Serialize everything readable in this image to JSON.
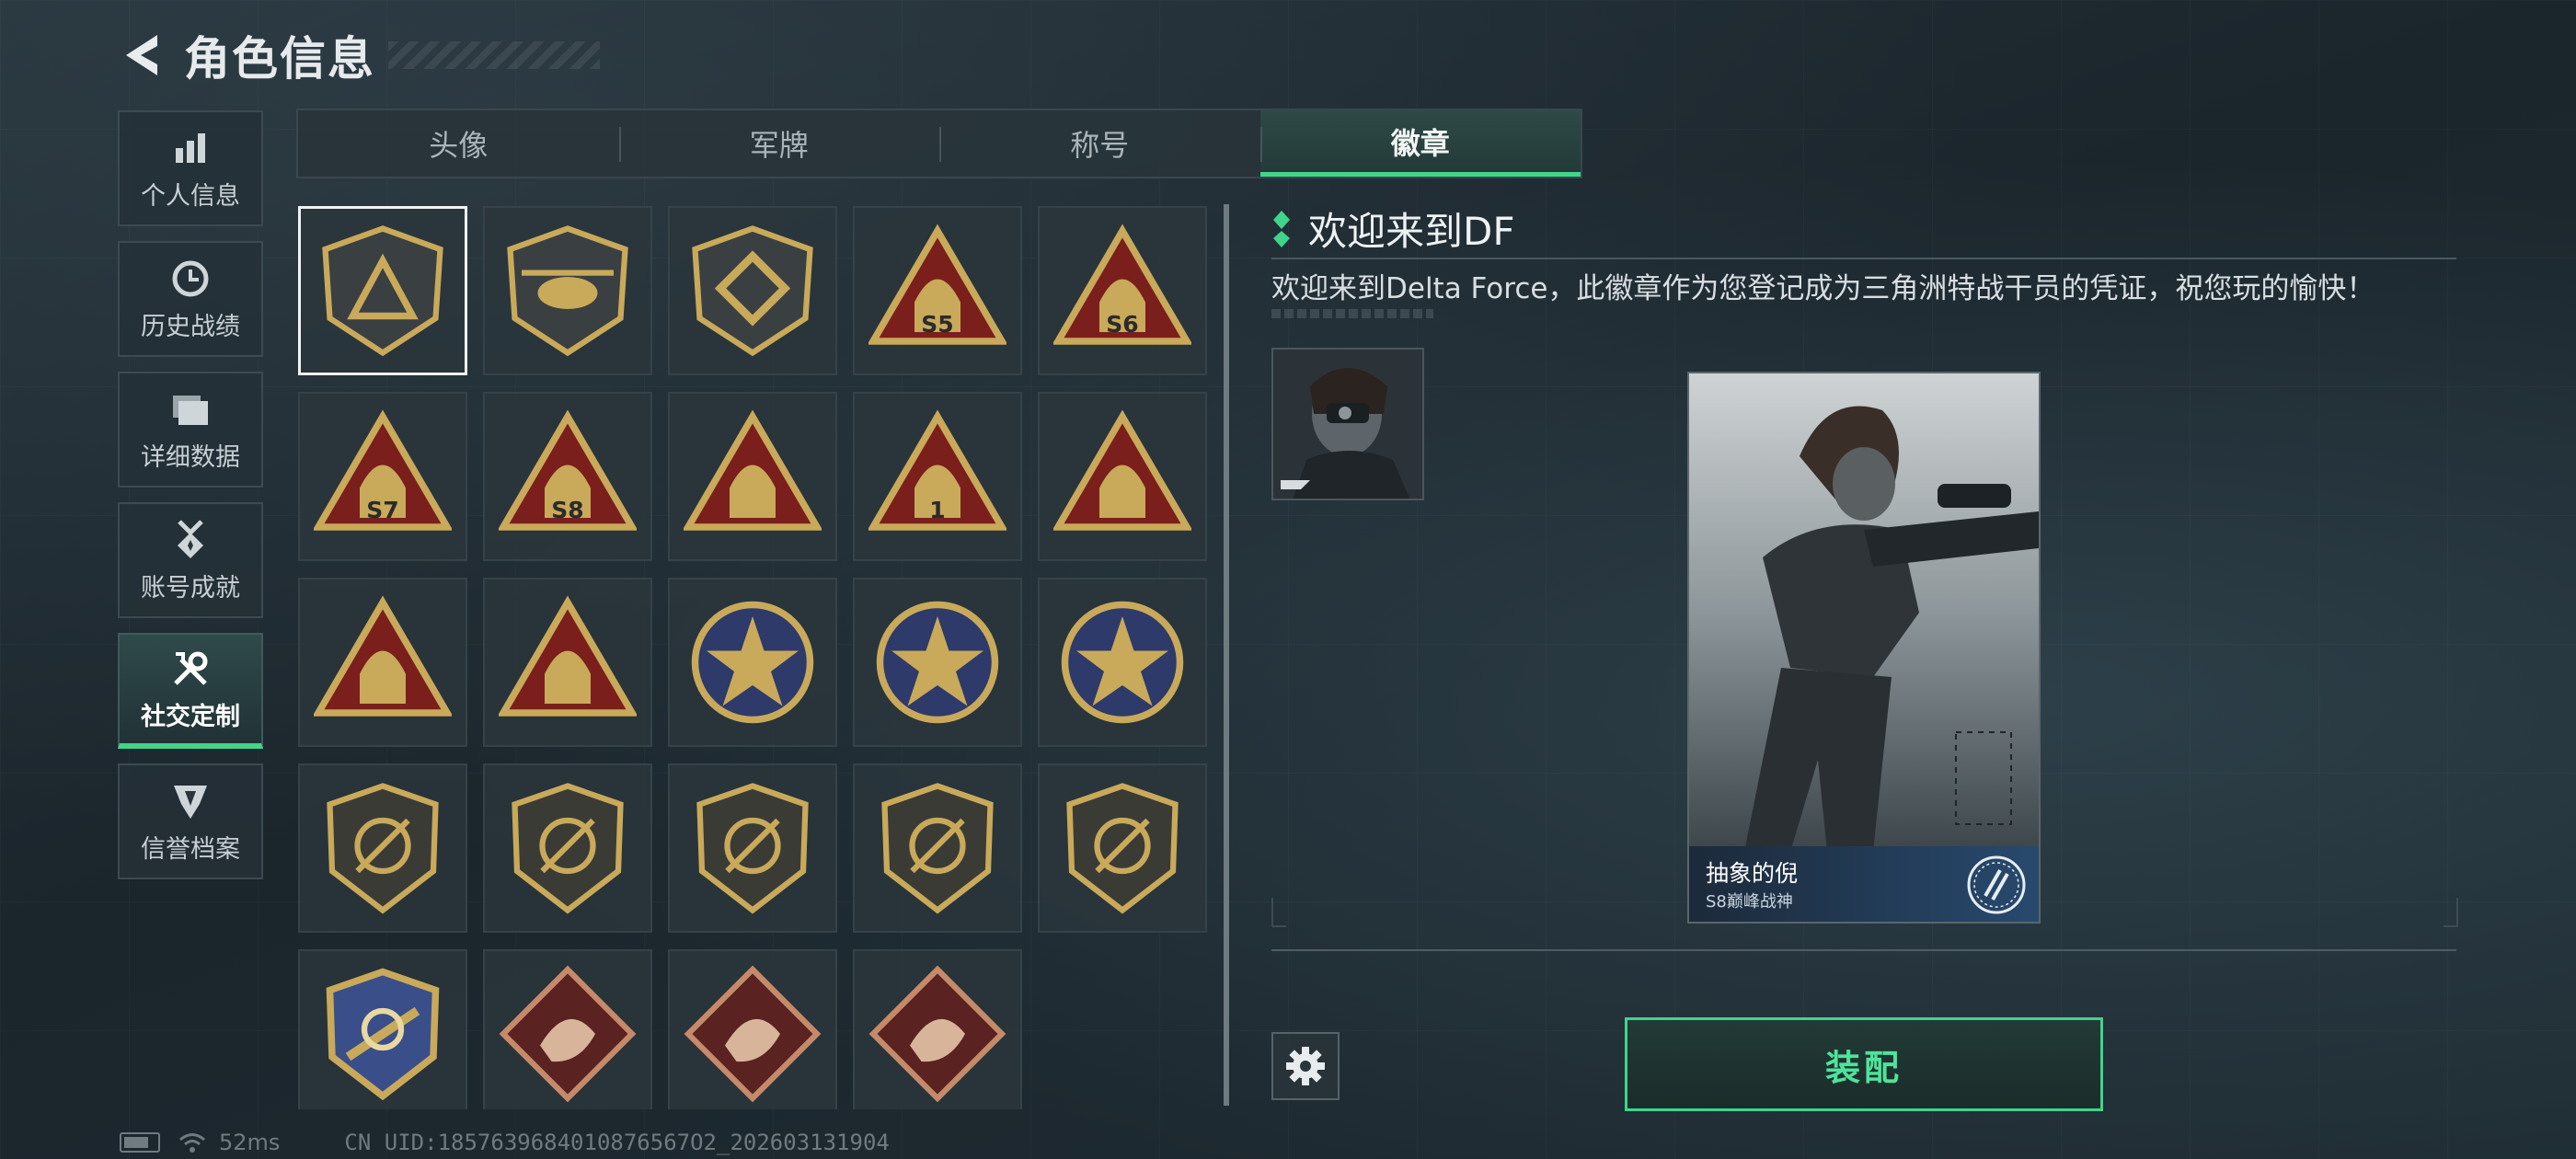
{
  "header": {
    "title": "角色信息",
    "back_icon": "back-arrow-icon"
  },
  "sidenav": {
    "items": [
      {
        "label": "个人信息",
        "icon": "bar-chart-icon",
        "active": false
      },
      {
        "label": "历史战绩",
        "icon": "clock-icon",
        "active": false
      },
      {
        "label": "详细数据",
        "icon": "folder-icon",
        "active": false
      },
      {
        "label": "账号成就",
        "icon": "medal-star-icon",
        "active": false
      },
      {
        "label": "社交定制",
        "icon": "wrench-screwdriver-icon",
        "active": true
      },
      {
        "label": "信誉档案",
        "icon": "shield-chevron-icon",
        "active": false
      }
    ]
  },
  "tabs": [
    {
      "label": "头像",
      "active": false
    },
    {
      "label": "军牌",
      "active": false
    },
    {
      "label": "称号",
      "active": false
    },
    {
      "label": "徽章",
      "active": true
    }
  ],
  "badges": [
    {
      "name": "delta-triangle-badge",
      "text": ""
    },
    {
      "name": "helicopter-badge",
      "text": ""
    },
    {
      "name": "hexagon-emblem-badge",
      "text": ""
    },
    {
      "name": "season-s5-badge",
      "text": "S5"
    },
    {
      "name": "season-s6-badge",
      "text": "S6"
    },
    {
      "name": "season-s7-badge",
      "text": "S7"
    },
    {
      "name": "season-s8-badge",
      "text": "S8"
    },
    {
      "name": "nest-eggs-badge",
      "text": ""
    },
    {
      "name": "number-one-badge",
      "text": "1"
    },
    {
      "name": "hands-gem-badge",
      "text": ""
    },
    {
      "name": "mech-soldiers-badge",
      "text": ""
    },
    {
      "name": "rocket-launch-badge",
      "text": ""
    },
    {
      "name": "star-compass-badge",
      "text": ""
    },
    {
      "name": "shield-chevron-badge",
      "text": ""
    },
    {
      "name": "laurel-shield-badge",
      "text": ""
    },
    {
      "name": "gem-shield-badge",
      "text": ""
    },
    {
      "name": "skull-crosshair-badge",
      "text": ""
    },
    {
      "name": "rifle-crossed-badge-1",
      "text": ""
    },
    {
      "name": "rifle-crossed-badge-2",
      "text": ""
    },
    {
      "name": "rifle-crossed-badge-3",
      "text": ""
    },
    {
      "name": "eagle-shield-badge",
      "text": ""
    },
    {
      "name": "dragon-badge-1",
      "text": ""
    },
    {
      "name": "dragon-badge-2",
      "text": ""
    },
    {
      "name": "runner-badge",
      "text": ""
    }
  ],
  "detail": {
    "title": "欢迎来到DF",
    "description": "欢迎来到Delta Force，此徽章作为您登记成为三角洲特战干员的凭证，祝您玩的愉快！",
    "card": {
      "name": "抽象的倪",
      "subtitle": "S8巅峰战神"
    },
    "equip_label": "装配",
    "settings_icon": "gear-icon"
  },
  "status": {
    "ping": "52ms",
    "uid": "CN UID:1857639684010876567O2_202603131904"
  },
  "colors": {
    "accent": "#3fd58a",
    "badge_gold": "#c9a95a",
    "badge_red": "#7a1f1c",
    "panel": "#2a363c"
  }
}
